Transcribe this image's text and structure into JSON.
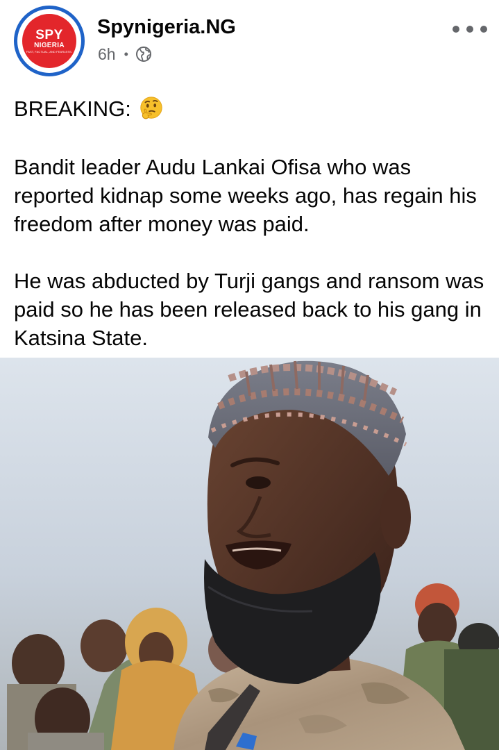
{
  "post": {
    "avatar": {
      "line1": "SPY",
      "line2": "NIGERIA",
      "line3": "FAST, FACTUAL, AND FEARLESS."
    },
    "author": "Spynigeria.NG",
    "timestamp": "6h",
    "separator": "•",
    "privacy_icon": "globe-icon",
    "more_icon": "more-options-icon",
    "headline": "BREAKING:",
    "headline_emoji": "thinking-face-emoji",
    "paragraph1": "Bandit leader Audu Lankai Ofisa who was reported kidnap some weeks ago, has regain his freedom after money was paid.",
    "paragraph2": "He was abducted by Turji gangs and ransom was paid so he has been released back to his gang in Katsina State."
  },
  "colors": {
    "avatar_ring": "#1f63c8",
    "avatar_fill": "#e3262b",
    "meta_text": "#65676b",
    "body_text": "#050505"
  }
}
